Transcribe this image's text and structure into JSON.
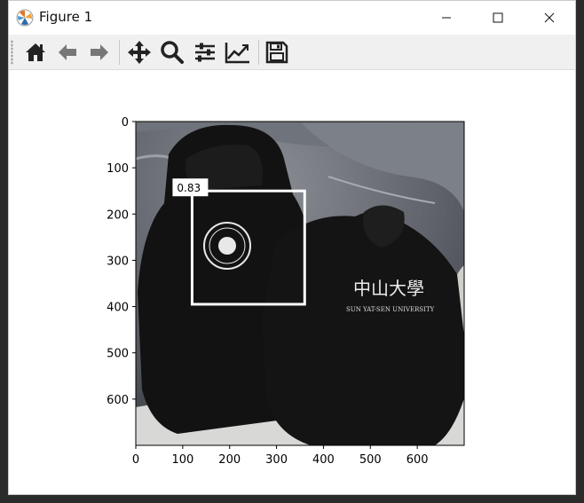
{
  "window": {
    "title": "Figure 1"
  },
  "toolbar": {
    "buttons": [
      {
        "name": "home",
        "icon": "home-icon"
      },
      {
        "name": "back",
        "icon": "arrow-left-icon"
      },
      {
        "name": "forward",
        "icon": "arrow-right-icon"
      },
      {
        "name": "pan",
        "icon": "move-icon"
      },
      {
        "name": "zoom",
        "icon": "zoom-icon"
      },
      {
        "name": "subplots",
        "icon": "sliders-icon"
      },
      {
        "name": "customize",
        "icon": "chart-line-icon"
      },
      {
        "name": "save",
        "icon": "floppy-disk-icon"
      }
    ]
  },
  "plot": {
    "image_description": "two black hoodies on crumpled grey sheet, Sun Yat-sen University logo and chinese characters",
    "image_text": "中山大學 SUN YAT-SEN UNIVERSITY",
    "x_ticks": [
      "0",
      "100",
      "200",
      "300",
      "400",
      "500",
      "600"
    ],
    "y_ticks": [
      "0",
      "100",
      "200",
      "300",
      "400",
      "500",
      "600"
    ],
    "xlim": [
      0,
      700
    ],
    "ylim": [
      700,
      0
    ],
    "detection": {
      "score_label": "0.83",
      "x0": 120,
      "y0": 150,
      "x1": 360,
      "y1": 395,
      "color": "#ffffff"
    }
  },
  "colors": {
    "titlebar": "#ffffff",
    "toolbar": "#f0f0f0",
    "icon": "#222222",
    "ide_bg": "#2b2b2b"
  }
}
